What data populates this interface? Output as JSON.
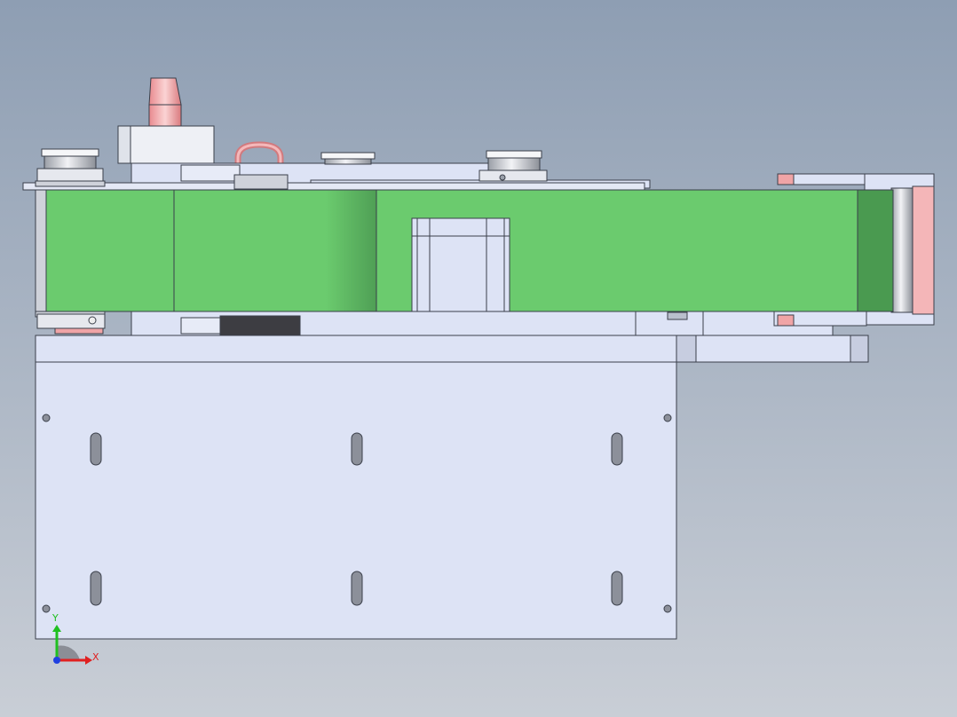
{
  "viewport": {
    "background_top": "#8e9eb3",
    "background_bottom": "#c9ced6"
  },
  "colors": {
    "belt_green": "#6bcb6e",
    "belt_dark": "#4a9a50",
    "part_lavender": "#dde3f5",
    "part_stroke": "#3a3f4a",
    "pink": "#f0a4a6",
    "bearing_gray": "#cfd2da",
    "dark_roller": "#3d3d42"
  },
  "triad": {
    "x_label": "X",
    "y_label": "Y",
    "x_color": "#e02020",
    "y_color": "#20c020",
    "z_color": "#2040e0"
  }
}
